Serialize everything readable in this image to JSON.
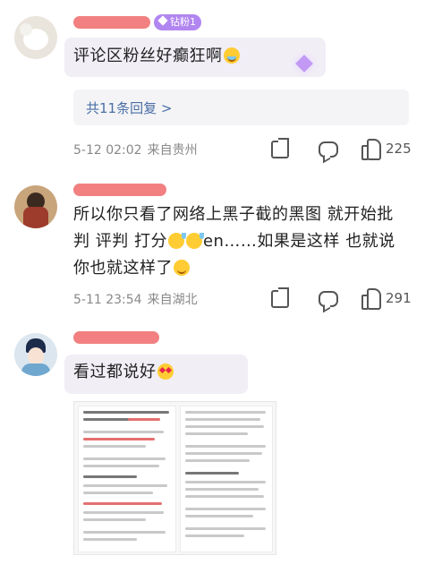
{
  "colors": {
    "badge": "#b186f0",
    "reply_link": "#4a6fa5",
    "meta": "#888888",
    "redacted_name": "#f06a6a",
    "highlight": "#f1eef6"
  },
  "comments": [
    {
      "badge": "钻粉1",
      "text": "评论区粉丝好癫狂啊",
      "emoji": "sweat-smile-emoji",
      "reply_link": "共11条回复 >",
      "time": "5-12 02:02",
      "location": "来自贵州",
      "likes": "225"
    },
    {
      "text_parts": [
        "所以你只看了网络上黑子截的黑图 就开始批判 评判 打分",
        "en……如果是这样 也就说你也就这样了"
      ],
      "time": "5-11 23:54",
      "location": "来自湖北",
      "likes": "291"
    },
    {
      "text": "看过都说好",
      "emoji": "heart-eyes-emoji",
      "image": "embedded-screenshot"
    }
  ]
}
